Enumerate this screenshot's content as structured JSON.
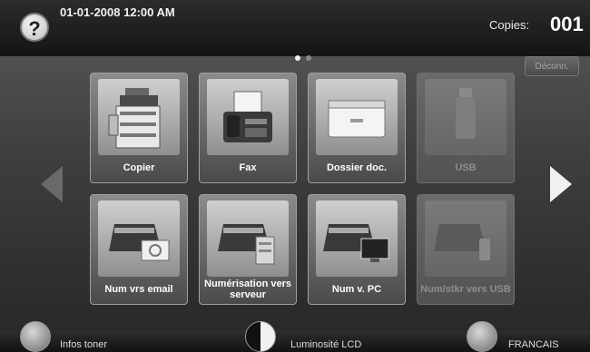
{
  "header": {
    "help_symbol": "?",
    "datetime": "01-01-2008 12:00 AM",
    "copies_label": "Copies:",
    "copies_value": "001"
  },
  "pager": {
    "pages": 2,
    "current": 1
  },
  "logout_button": {
    "label": "Déconn."
  },
  "tiles": [
    {
      "label": "Copier",
      "icon": "copier-icon",
      "enabled": true
    },
    {
      "label": "Fax",
      "icon": "fax-icon",
      "enabled": true
    },
    {
      "label": "Dossier doc.",
      "icon": "document-box-icon",
      "enabled": true
    },
    {
      "label": "USB",
      "icon": "usb-stick-icon",
      "enabled": false
    },
    {
      "label": "Num vrs email",
      "icon": "scan-to-email-icon",
      "enabled": true
    },
    {
      "label": "Numérisation vers serveur",
      "icon": "scan-to-server-icon",
      "enabled": true
    },
    {
      "label": "Num v. PC",
      "icon": "scan-to-pc-icon",
      "enabled": true
    },
    {
      "label": "Num/stkr vers USB",
      "icon": "scan-to-usb-icon",
      "enabled": false
    }
  ],
  "bottom": {
    "toner_label": "Infos toner",
    "brightness_label": "Luminosité LCD",
    "language_label": "FRANCAIS"
  },
  "colors": {
    "accent": "#f0f0f0",
    "disabled": "#8e8e8e",
    "background": "#3e3e3e"
  }
}
